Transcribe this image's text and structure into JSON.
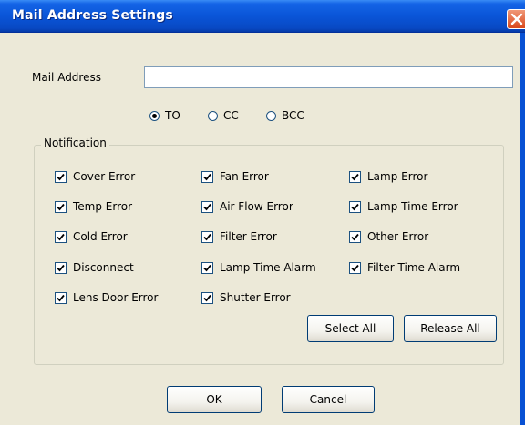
{
  "window": {
    "title": "Mail Address Settings"
  },
  "mail_address": {
    "label": "Mail Address",
    "value": ""
  },
  "recipient_type": {
    "options": [
      {
        "label": "TO",
        "selected": true
      },
      {
        "label": "CC",
        "selected": false
      },
      {
        "label": "BCC",
        "selected": false
      }
    ]
  },
  "notification": {
    "group_label": "Notification",
    "items": [
      {
        "label": "Cover Error",
        "checked": true
      },
      {
        "label": "Fan Error",
        "checked": true
      },
      {
        "label": "Lamp Error",
        "checked": true
      },
      {
        "label": "Temp Error",
        "checked": true
      },
      {
        "label": "Air Flow Error",
        "checked": true
      },
      {
        "label": "Lamp Time Error",
        "checked": true
      },
      {
        "label": "Cold Error",
        "checked": true
      },
      {
        "label": "Filter Error",
        "checked": true
      },
      {
        "label": "Other Error",
        "checked": true
      },
      {
        "label": "Disconnect",
        "checked": true
      },
      {
        "label": "Lamp Time Alarm",
        "checked": true
      },
      {
        "label": "Filter Time Alarm",
        "checked": true
      },
      {
        "label": "Lens Door Error",
        "checked": true
      },
      {
        "label": "Shutter Error",
        "checked": true
      }
    ],
    "select_all_label": "Select All",
    "release_all_label": "Release All"
  },
  "footer": {
    "ok_label": "OK",
    "cancel_label": "Cancel"
  }
}
